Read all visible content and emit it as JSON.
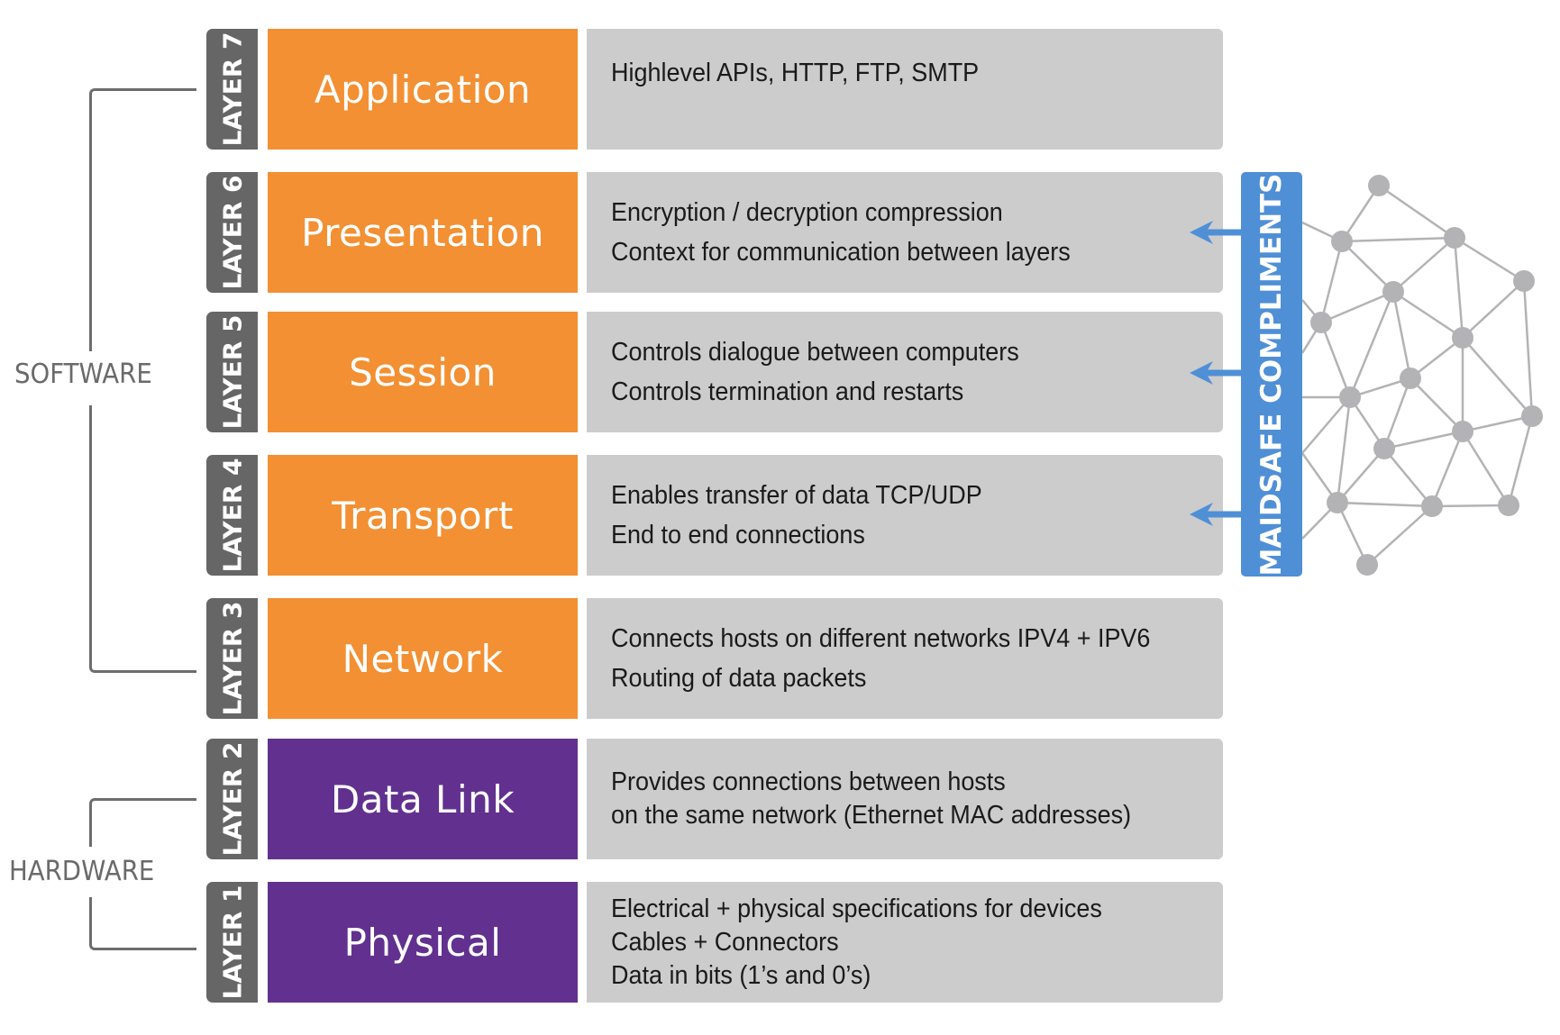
{
  "groups": {
    "software": {
      "label": "SOFTWARE"
    },
    "hardware": {
      "label": "HARDWARE"
    }
  },
  "layers": [
    {
      "tab": "LAYER 7",
      "name": "Application",
      "group": "software",
      "description": [
        "Highlevel APIs, HTTP, FTP, SMTP"
      ]
    },
    {
      "tab": "LAYER 6",
      "name": "Presentation",
      "group": "software",
      "description": [
        "Encryption / decryption compression",
        "Context for communication between layers"
      ]
    },
    {
      "tab": "LAYER 5",
      "name": "Session",
      "group": "software",
      "description": [
        "Controls dialogue between computers",
        "Controls termination and restarts"
      ]
    },
    {
      "tab": "LAYER 4",
      "name": "Transport",
      "group": "software",
      "description": [
        "Enables transfer of data TCP/UDP",
        "End to end connections"
      ]
    },
    {
      "tab": "LAYER 3",
      "name": "Network",
      "group": "software",
      "description": [
        "Connects hosts on different networks IPV4 + IPV6",
        "Routing of data packets"
      ]
    },
    {
      "tab": "LAYER 2",
      "name": "Data Link",
      "group": "hardware",
      "description": [
        "Provides connections between hosts",
        "on the same network (Ethernet MAC addresses)"
      ]
    },
    {
      "tab": "LAYER 1",
      "name": "Physical",
      "group": "hardware",
      "description": [
        "Electrical + physical specifications for devices",
        "Cables + Connectors",
        "Data in bits (1’s and 0’s)"
      ]
    }
  ],
  "maidsafe": {
    "label": "MAIDSAFE COMPLIMENTS",
    "points_to_layers": [
      "LAYER 6",
      "LAYER 5",
      "LAYER 4"
    ],
    "icon": "network-mesh-icon"
  },
  "colors": {
    "software": "#f29033",
    "hardware": "#62318f",
    "layer_tab": "#666666",
    "description_bg": "#cccccc",
    "maidsafe_blue": "#4f8fd6",
    "mesh_gray": "#b3b3b5"
  }
}
